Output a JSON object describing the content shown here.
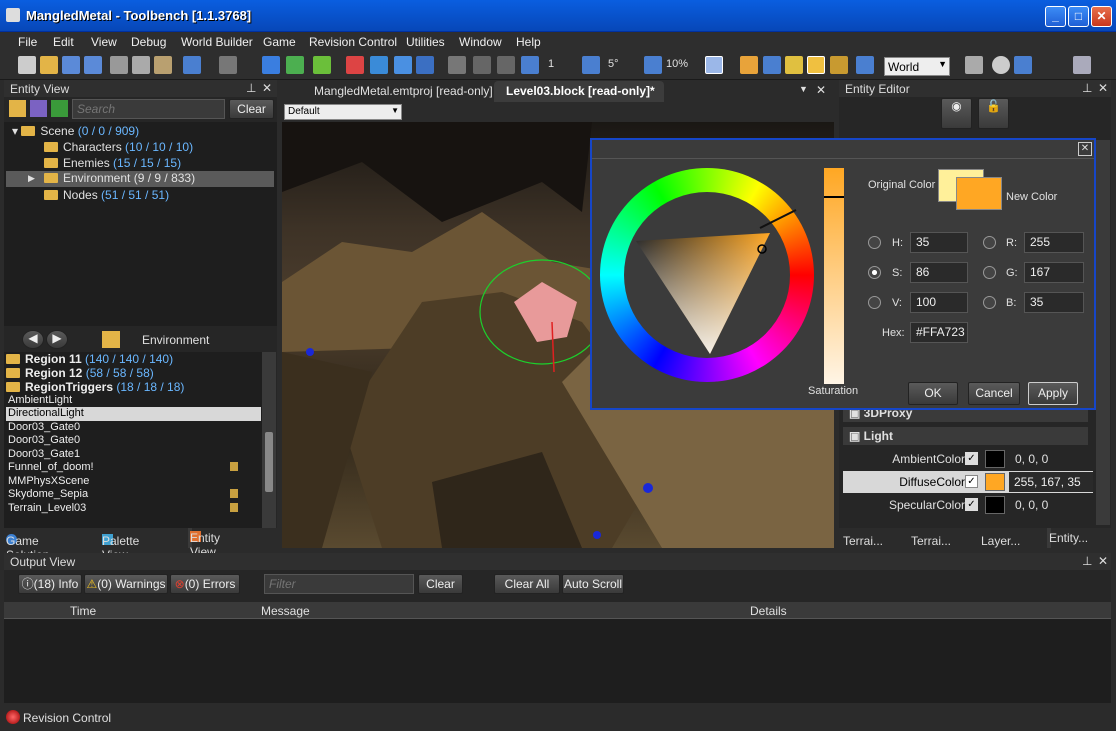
{
  "window": {
    "title": "MangledMetal - Toolbench [1.1.3768]"
  },
  "menu": [
    "File",
    "Edit",
    "View",
    "Debug",
    "World Builder",
    "Game",
    "Revision Control",
    "Utilities",
    "Window",
    "Help"
  ],
  "toolbar": {
    "snap_count": "1",
    "angle": "5°",
    "percent": "10%",
    "space": "World"
  },
  "entity_view": {
    "title": "Entity View",
    "search_placeholder": "Search",
    "clear": "Clear",
    "tree": [
      {
        "label": "Scene",
        "count": "(0 / 0 / 909)"
      },
      {
        "label": "Characters",
        "count": "(10 / 10 / 10)"
      },
      {
        "label": "Enemies",
        "count": "(15 / 15 / 15)"
      },
      {
        "label": "Environment",
        "count": "(9 / 9 / 833)"
      },
      {
        "label": "Nodes",
        "count": "(51 / 51 / 51)"
      }
    ],
    "breadcrumb": "Environment",
    "list": [
      {
        "label": "Region 11",
        "count": "(140 / 140 / 140)"
      },
      {
        "label": "Region 12",
        "count": "(58 / 58 / 58)"
      },
      {
        "label": "RegionTriggers",
        "count": "(18 / 18 / 18)"
      }
    ],
    "items": [
      "AmbientLight",
      "DirectionalLight",
      "Door03_Gate0",
      "Door03_Gate0",
      "Door03_Gate1",
      "Funnel_of_doom!",
      "MMPhysXScene",
      "Skydome_Sepia",
      "Terrain_Level03"
    ],
    "tabs": [
      "Game Solution",
      "Palette View",
      "Entity View"
    ]
  },
  "doc_tabs": {
    "tab1": "MangledMetal.emtproj [read-only]",
    "tab2": "Level03.block [read-only]*",
    "camera": "Default"
  },
  "entity_editor": {
    "title": "Entity Editor",
    "section_3d": "3DProxy",
    "section_light": "Light",
    "props": [
      {
        "name": "AmbientColor",
        "value": "0, 0, 0",
        "color": "#000000"
      },
      {
        "name": "DiffuseColor",
        "value": "255, 167, 35",
        "color": "#ffa723"
      },
      {
        "name": "SpecularColor",
        "value": "0, 0, 0",
        "color": "#000000"
      }
    ],
    "tabs": [
      "Terrai...",
      "Terrai...",
      "Layer...",
      "Entity..."
    ]
  },
  "color_dialog": {
    "original_label": "Original Color",
    "new_label": "New Color",
    "original_color": "#fff09a",
    "new_color": "#ffa723",
    "h_label": "H:",
    "h": "35",
    "s_label": "S:",
    "s": "86",
    "v_label": "V:",
    "v": "100",
    "r_label": "R:",
    "r": "255",
    "g_label": "G:",
    "g": "167",
    "b_label": "B:",
    "b": "35",
    "hex_label": "Hex:",
    "hex": "#FFA723",
    "slider_label": "Saturation",
    "ok": "OK",
    "cancel": "Cancel",
    "apply": "Apply"
  },
  "output": {
    "title": "Output View",
    "info": "(18) Info",
    "warnings": "(0) Warnings",
    "errors": "(0) Errors",
    "filter_placeholder": "Filter",
    "clear": "Clear",
    "clear_all": "Clear All",
    "auto_scroll": "Auto Scroll",
    "columns": [
      "Time",
      "Message",
      "Details"
    ]
  },
  "status": {
    "text": "Revision Control"
  }
}
